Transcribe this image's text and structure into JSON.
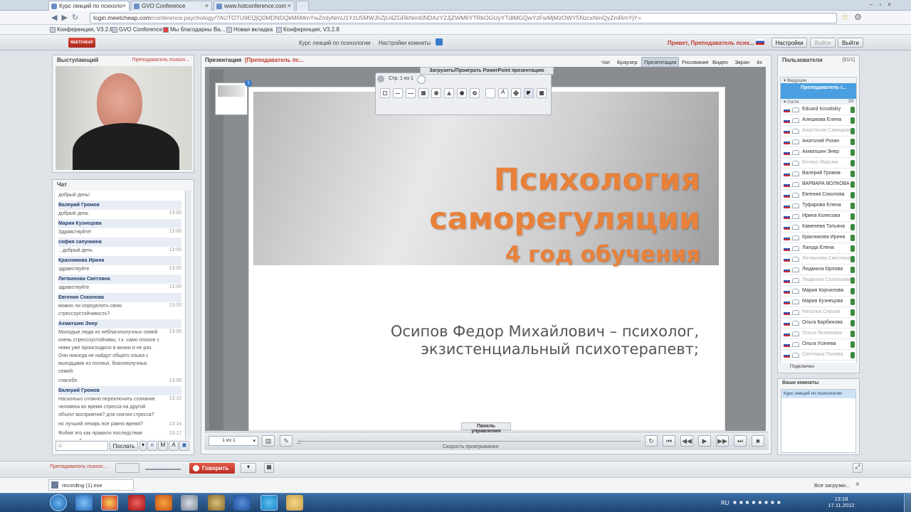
{
  "browser": {
    "tabs": [
      {
        "label": "Курс лекций по психоло",
        "active": true
      },
      {
        "label": "GVO Conference",
        "active": false
      },
      {
        "label": "www.hotconference.com",
        "active": false
      }
    ],
    "url_host": "login.meetcheap.com",
    "url_rest": "/conference.psychology/?AUTOTU9EQjQ0MDNDQkM6MmYwZmlyNmU1YzU5MWJhZjU4ZGRkNmI0NDAzY2JjZWM6YTRkOGUyYTdlMGQwYzFwMjMzOWY5NzcxNmQyZmRmYjY=",
    "bookmarks": [
      "Конференция, V3.2.8",
      "GVO Conference",
      "Мы благодарны Ва...",
      "Новая вкладка",
      "Конференция, V3.2.8"
    ]
  },
  "app": {
    "logo_text": "MEETCHEAP",
    "room_title": "Курс лекций по психологии",
    "room_settings": "Настройки комнаты",
    "greeting": "Привет, Преподаватель псих...",
    "settings_button": "Настройки",
    "login_button": "Войти",
    "logout_button": "Выйти"
  },
  "speaker": {
    "title": "Выступающий",
    "name": "Преподаватель психол..."
  },
  "chat": {
    "title": "Чат",
    "first_line": "добрый день!",
    "messages": [
      {
        "who": "Валерий Громов",
        "text": "добрый день",
        "time": "13:00"
      },
      {
        "who": "Мария Кузнецова",
        "text": "Здравствуйте!",
        "time": "13:00"
      },
      {
        "who": "софия сапункина",
        "text": "...добрый день",
        "time": "13:00"
      },
      {
        "who": "Красникова Ирина",
        "text": "здравствуйте",
        "time": "13:00"
      },
      {
        "who": "Литвинова Светлана",
        "text": "здравствуйте",
        "time": "13:00"
      },
      {
        "who": "Евгения Соколова",
        "text": "можно ли определить свою стрессоустойчивость?",
        "time": "13:03"
      },
      {
        "who": "Ахматшин Энер",
        "text": "Молодые люди из неблагополучных семей очень стрессоустойчивы, т.к. само плохое с ними уже происходило в жизни и не раз. Они никогда не найдут общего языка с выходцами из полных, благополучных семей.",
        "time": "13:06"
      },
      {
        "who": "",
        "text": "спасибо",
        "time": "13:09"
      },
      {
        "who": "Валерий Громов",
        "text": "Насколько сложно переключить сознание человека во время стресса на другой объект восприятия? для снятия стресса?",
        "time": "13:10"
      },
      {
        "who": "",
        "text": "но лучший лекарь все равно время?",
        "time": "13:14"
      },
      {
        "who": "",
        "text": "Фобия это как правило последствия стрессов?",
        "time": "13:17"
      }
    ],
    "input_placeholder": "",
    "send_button": "Послать"
  },
  "presentation": {
    "label": "Презентация",
    "presenter": "[Преподаватель пс...",
    "tabs": [
      "Чат",
      "Браузер",
      "Презентация",
      "Рисование",
      "Видео",
      "Экран",
      "4х"
    ],
    "selected_tab": "Презентация",
    "upload_label": "Загрузить/Проиграть PowerPoint презентацию",
    "page_label": "Стр. 1 из 1",
    "thumb_badge": "1",
    "slide": {
      "title_line1": "Психология",
      "title_line2": "саморегуляции",
      "title_line3": "4 год обучения",
      "author_line1": "Осипов Федор Михайлович – психолог,",
      "author_line2": "экзистенциальный психотерапевт;"
    },
    "page_select": "1 из 1",
    "control_panel": "Панель управления",
    "playback_speed": "Скорость проигрывания"
  },
  "users": {
    "title": "Пользователи",
    "count": "[31/1]",
    "group_leads": "Ведущие",
    "lead_user": "Преподаватель г...",
    "group_guests": "Гости",
    "guest_count": "29",
    "list": [
      {
        "name": "Eduard Kovalskiy",
        "dim": false
      },
      {
        "name": "Алешкова Елена",
        "dim": false
      },
      {
        "name": "Анастасия Савицкая",
        "dim": true
      },
      {
        "name": "Анатолий Розин",
        "dim": false
      },
      {
        "name": "Ахматшин Энер",
        "dim": false
      },
      {
        "name": "Беляус Максим",
        "dim": true
      },
      {
        "name": "Валерий Громов",
        "dim": false
      },
      {
        "name": "ВАРВАРА ВОЛКОВА",
        "dim": false
      },
      {
        "name": "Евгения Соколова",
        "dim": false
      },
      {
        "name": "Туфарова Елена",
        "dim": false
      },
      {
        "name": "Ирина Колесова",
        "dim": false
      },
      {
        "name": "Каменева Татьяна",
        "dim": false
      },
      {
        "name": "Красникова Ирина",
        "dim": false
      },
      {
        "name": "Лагода Елена",
        "dim": false
      },
      {
        "name": "Литвинова Светлана",
        "dim": true
      },
      {
        "name": "Людмила Орлова",
        "dim": false
      },
      {
        "name": "Людмила Соловьева",
        "dim": true
      },
      {
        "name": "Мария Корчилова",
        "dim": false
      },
      {
        "name": "Мария Кузнецова",
        "dim": false
      },
      {
        "name": "Наталья Серова",
        "dim": true
      },
      {
        "name": "Ольга Барбинова",
        "dim": false
      },
      {
        "name": "Ольга Литвинова",
        "dim": true
      },
      {
        "name": "Ольга Усачева",
        "dim": false
      },
      {
        "name": "Светлана Попова",
        "dim": true
      }
    ],
    "connected": "Подключен",
    "rooms_title": "Ваши комнаты",
    "room_item": "Курс лекций по психологии"
  },
  "bottom": {
    "user_label": "Преподаватель психол...",
    "talk_button": "Говорить"
  },
  "download": {
    "file": "recording (1).exe",
    "show_all": "Все загрузки..."
  },
  "taskbar": {
    "lang": "RU",
    "time": "13:18",
    "date": "17.11.2012"
  },
  "colors": {
    "accent_orange": "#e8813a",
    "brand_red": "#c0392b",
    "link_blue": "#1f3a6a"
  }
}
